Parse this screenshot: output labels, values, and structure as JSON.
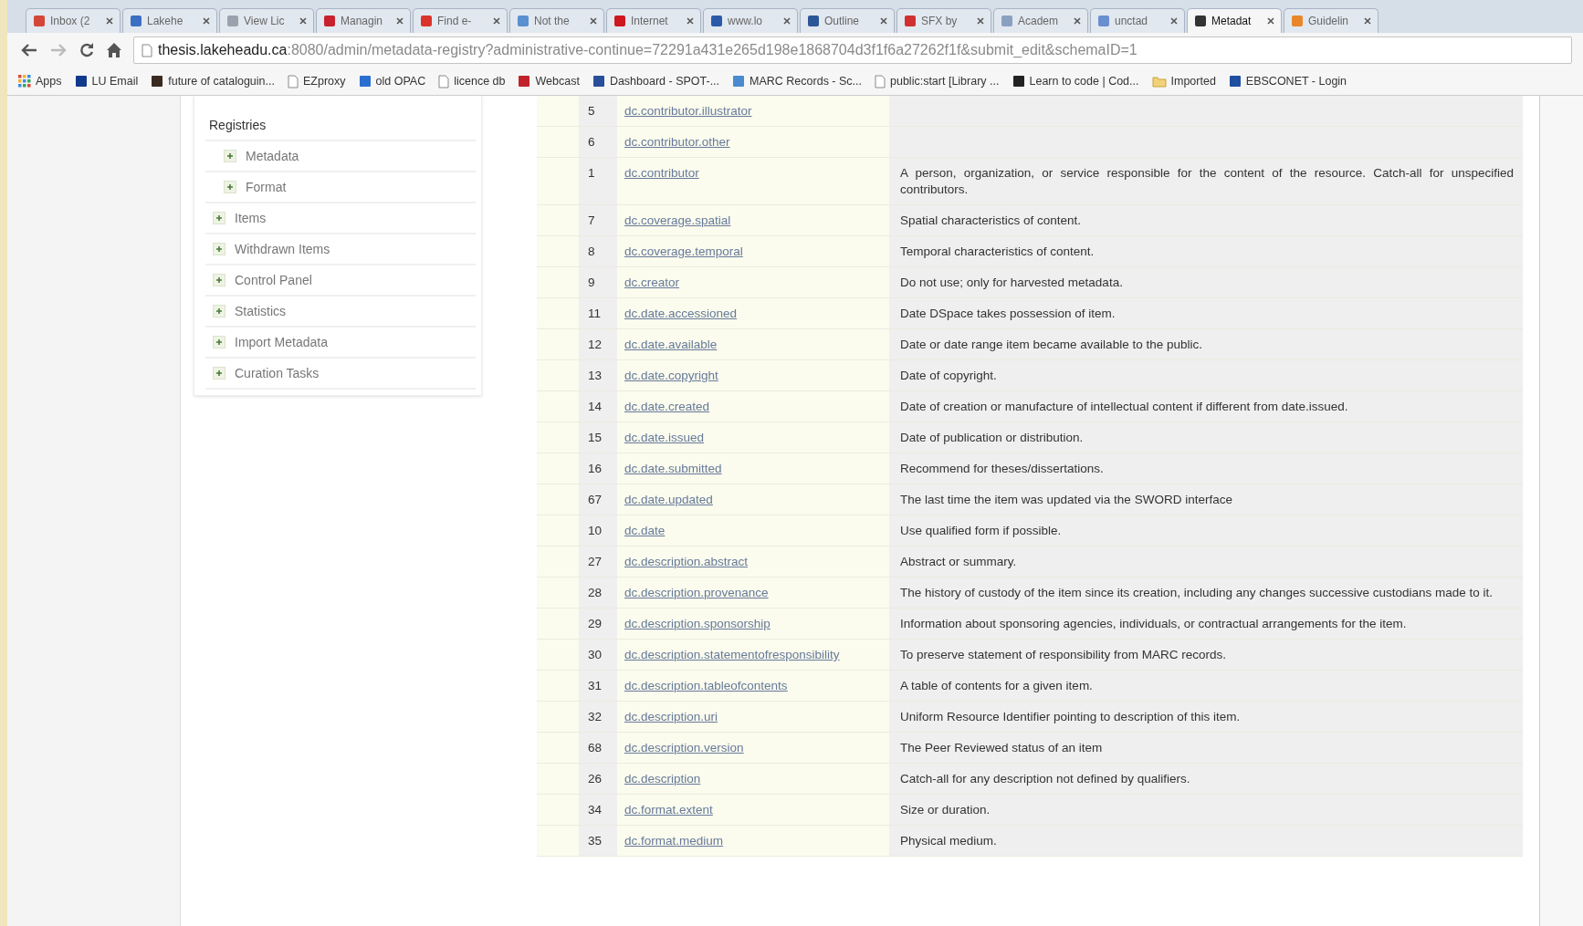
{
  "tabs": [
    {
      "label": "Inbox (2",
      "selected": false
    },
    {
      "label": "Lakehe",
      "selected": false
    },
    {
      "label": "View Lic",
      "selected": false
    },
    {
      "label": "Managin",
      "selected": false
    },
    {
      "label": "Find e-",
      "selected": false
    },
    {
      "label": "Not the",
      "selected": false
    },
    {
      "label": "Internet",
      "selected": false
    },
    {
      "label": "www.lo",
      "selected": false
    },
    {
      "label": "Outline",
      "selected": false
    },
    {
      "label": "SFX by",
      "selected": false
    },
    {
      "label": "Academ",
      "selected": false
    },
    {
      "label": "unctad",
      "selected": false
    },
    {
      "label": "Metadat",
      "selected": true
    },
    {
      "label": "Guidelin",
      "selected": false
    }
  ],
  "address": {
    "host": "thesis.lakeheadu.ca",
    "path": ":8080/admin/metadata-registry?administrative-continue=72291a431e265d198e1868704d3f1f6a27262f1f&submit_edit&schemaID=1"
  },
  "bookmarks": [
    {
      "label": "Apps",
      "kind": "apps"
    },
    {
      "label": "LU Email",
      "kind": "site"
    },
    {
      "label": "future of cataloguin...",
      "kind": "site"
    },
    {
      "label": "EZproxy",
      "kind": "page"
    },
    {
      "label": "old OPAC",
      "kind": "site"
    },
    {
      "label": "licence db",
      "kind": "page"
    },
    {
      "label": "Webcast",
      "kind": "site"
    },
    {
      "label": "Dashboard - SPOT-...",
      "kind": "site"
    },
    {
      "label": "MARC Records - Sc...",
      "kind": "site"
    },
    {
      "label": "public:start [Library ...",
      "kind": "page"
    },
    {
      "label": "Learn to code | Cod...",
      "kind": "site"
    },
    {
      "label": "Imported",
      "kind": "folder"
    },
    {
      "label": "EBSCONET - Login",
      "kind": "site"
    }
  ],
  "sidebar": {
    "items": [
      {
        "label": "Registries",
        "kind": "heading",
        "children": [
          {
            "label": "Metadata",
            "kind": "link"
          },
          {
            "label": "Format",
            "kind": "link"
          }
        ]
      },
      {
        "label": "Items",
        "kind": "link"
      },
      {
        "label": "Withdrawn Items",
        "kind": "link"
      },
      {
        "label": "Control Panel",
        "kind": "link"
      },
      {
        "label": "Statistics",
        "kind": "link"
      },
      {
        "label": "Import Metadata",
        "kind": "link"
      },
      {
        "label": "Curation Tasks",
        "kind": "link"
      }
    ]
  },
  "table": {
    "rows": [
      {
        "id": "5",
        "field": "dc.contributor.illustrator"
      },
      {
        "id": "6",
        "field": "dc.contributor.other"
      },
      {
        "id": "1",
        "field": "dc.contributor",
        "note": "A person, organization, or service responsible for the content of the resource. Catch-all for unspecified contributors."
      },
      {
        "id": "7",
        "field": "dc.coverage.spatial",
        "note": "Spatial characteristics of content."
      },
      {
        "id": "8",
        "field": "dc.coverage.temporal",
        "note": "Temporal characteristics of content."
      },
      {
        "id": "9",
        "field": "dc.creator",
        "note": "Do not use; only for harvested metadata."
      },
      {
        "id": "11",
        "field": "dc.date.accessioned",
        "note": "Date DSpace takes possession of item."
      },
      {
        "id": "12",
        "field": "dc.date.available",
        "note": "Date or date range item became available to the public."
      },
      {
        "id": "13",
        "field": "dc.date.copyright",
        "note": "Date of copyright."
      },
      {
        "id": "14",
        "field": "dc.date.created",
        "note": "Date of creation or manufacture of intellectual content if different from date.issued."
      },
      {
        "id": "15",
        "field": "dc.date.issued",
        "note": "Date of publication or distribution."
      },
      {
        "id": "16",
        "field": "dc.date.submitted",
        "note": "Recommend for theses/dissertations."
      },
      {
        "id": "67",
        "field": "dc.date.updated",
        "note": "The last time the item was updated via the SWORD interface"
      },
      {
        "id": "10",
        "field": "dc.date",
        "note": "Use qualified form if possible."
      },
      {
        "id": "27",
        "field": "dc.description.abstract",
        "note": "Abstract or summary."
      },
      {
        "id": "28",
        "field": "dc.description.provenance",
        "note": "The history of custody of the item since its creation, including any changes successive custodians made to it."
      },
      {
        "id": "29",
        "field": "dc.description.sponsorship",
        "note": "Information about sponsoring agencies, individuals, or contractual arrangements for the item."
      },
      {
        "id": "30",
        "field": "dc.description.statementofresponsibility",
        "note": "To preserve statement of responsibility from MARC records."
      },
      {
        "id": "31",
        "field": "dc.description.tableofcontents",
        "note": "A table of contents for a given item."
      },
      {
        "id": "32",
        "field": "dc.description.uri",
        "note": "Uniform Resource Identifier pointing to description of this item."
      },
      {
        "id": "68",
        "field": "dc.description.version",
        "note": "The Peer Reviewed status of an item"
      },
      {
        "id": "26",
        "field": "dc.description",
        "note": "Catch-all for any description not defined by qualifiers."
      },
      {
        "id": "34",
        "field": "dc.format.extent",
        "note": "Size or duration."
      },
      {
        "id": "35",
        "field": "dc.format.medium",
        "note": "Physical medium."
      }
    ]
  }
}
